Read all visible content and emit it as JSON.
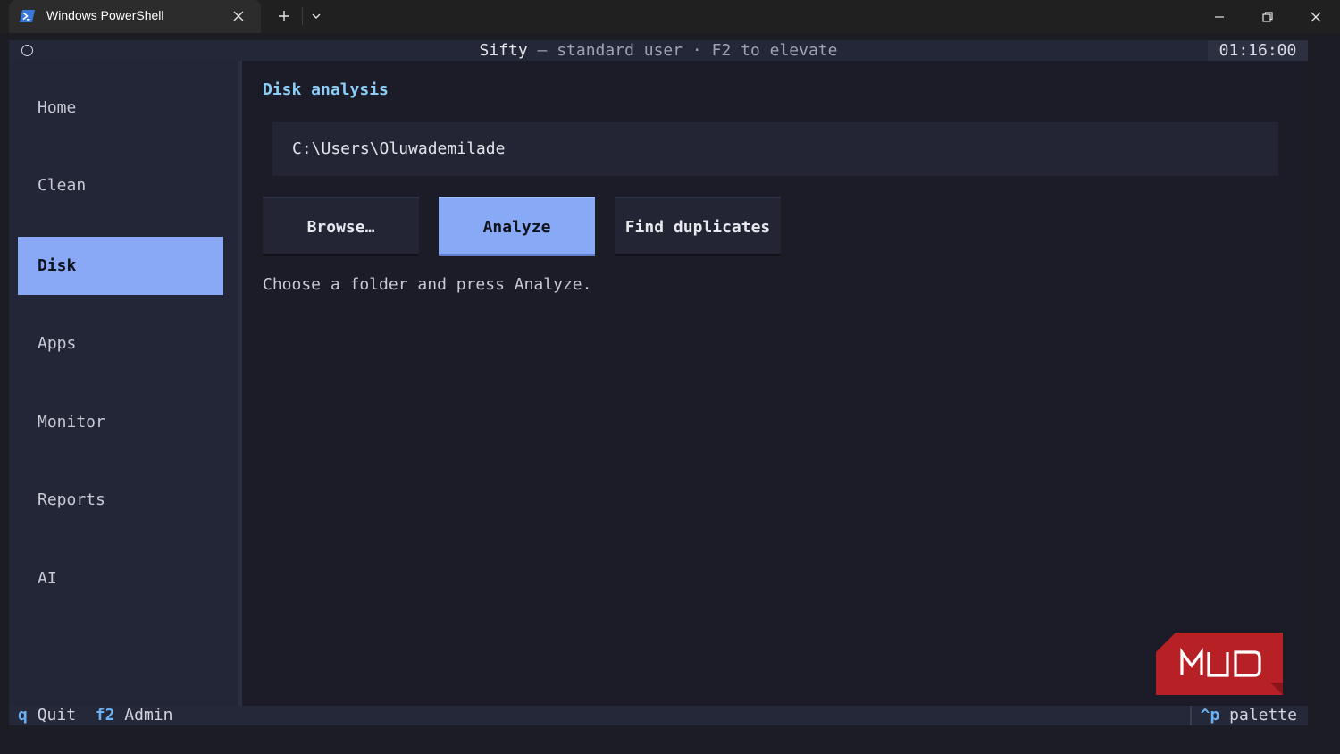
{
  "window": {
    "tab_title": "Windows PowerShell"
  },
  "header": {
    "app_name": "Sifty",
    "subtitle": " — standard user · F2 to elevate",
    "clock": "01:16:00"
  },
  "sidebar": {
    "items": [
      {
        "label": "Home",
        "active": false
      },
      {
        "label": "Clean",
        "active": false
      },
      {
        "label": "Disk",
        "active": true
      },
      {
        "label": "Apps",
        "active": false
      },
      {
        "label": "Monitor",
        "active": false
      },
      {
        "label": "Reports",
        "active": false
      },
      {
        "label": "AI",
        "active": false
      }
    ]
  },
  "main": {
    "title": "Disk analysis",
    "path_value": "C:\\Users\\Oluwademilade",
    "buttons": {
      "browse": "Browse…",
      "analyze": "Analyze",
      "find_duplicates": "Find duplicates"
    },
    "status": "Choose a folder and press Analyze."
  },
  "footer": {
    "quit_key": "q",
    "quit_label": "Quit",
    "admin_key": "f2",
    "admin_label": "Admin",
    "palette_key": "^p",
    "palette_label": "palette"
  },
  "watermark": {
    "text": "MUO"
  },
  "colors": {
    "accent": "#89a8f5",
    "section_title": "#8ecdf7",
    "key_hint": "#6ab0f3",
    "watermark": "#b72025"
  }
}
